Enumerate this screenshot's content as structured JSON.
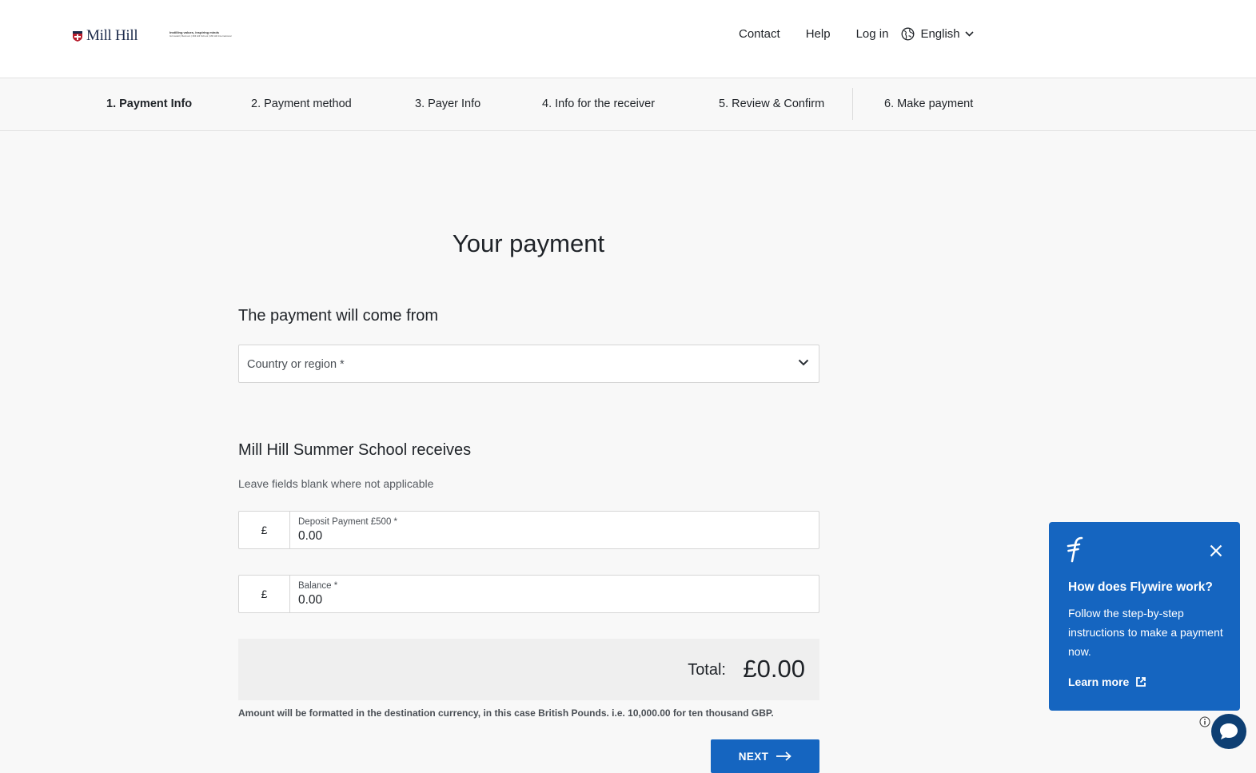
{
  "header": {
    "logo_text": "Mill Hill",
    "tagline_line1": "Instilling values, inspiring minds",
    "tagline_line2": "Grimsdell | Belmont | Mill Hill School | Mill Hill International",
    "nav": {
      "contact": "Contact",
      "help": "Help",
      "login": "Log in",
      "language": "English"
    },
    "icons": {
      "language": "globe-icon",
      "language_dropdown": "chevron-down-icon"
    }
  },
  "steps": [
    {
      "label": "1. Payment Info",
      "active": true
    },
    {
      "label": "2. Payment method",
      "active": false
    },
    {
      "label": "3. Payer Info",
      "active": false
    },
    {
      "label": "4. Info for the receiver",
      "active": false
    },
    {
      "label": "5. Review & Confirm",
      "active": false
    },
    {
      "label": "6. Make payment",
      "active": false
    }
  ],
  "main": {
    "title": "Your payment",
    "from_section": {
      "title": "The payment will come from",
      "country_placeholder": "Country or region *"
    },
    "receiver_section": {
      "title": "Mill Hill Summer School receives",
      "hint": "Leave fields blank where not applicable",
      "fields": [
        {
          "currency": "£",
          "label": "Deposit Payment £500 *",
          "value": "0.00"
        },
        {
          "currency": "£",
          "label": "Balance *",
          "value": "0.00"
        }
      ]
    },
    "total": {
      "label": "Total:",
      "value": "£0.00"
    },
    "fineprint": "Amount will be formatted in the destination currency, in this case British Pounds. i.e. 10,000.00 for ten thousand GBP.",
    "next_button": "NEXT"
  },
  "popup": {
    "heading": "How does Flywire work?",
    "body": "Follow the step-by-step instructions to make a payment now.",
    "learn_more": "Learn more",
    "colors": {
      "background": "#1565c0",
      "text": "#ffffff"
    }
  },
  "colors": {
    "primary": "#1565c0",
    "page_bg": "#f8f8f8",
    "chat": "#0e3f73"
  }
}
